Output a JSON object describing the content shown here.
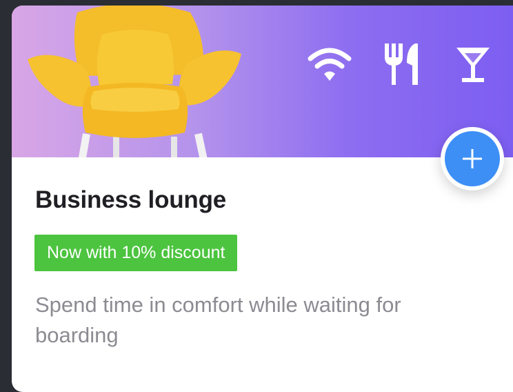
{
  "card": {
    "title": "Business lounge",
    "badge": "Now with 10% discount",
    "description": "Spend time in comfort while waiting for boarding",
    "amenities": [
      {
        "icon": "wifi-icon"
      },
      {
        "icon": "fork-knife-icon"
      },
      {
        "icon": "cocktail-icon"
      }
    ],
    "add_action_icon": "plus-icon",
    "colors": {
      "accent": "#3d8ff6",
      "badge": "#4cc43f",
      "banner_start": "#d8a6e6",
      "banner_end": "#7a5cf2"
    }
  }
}
